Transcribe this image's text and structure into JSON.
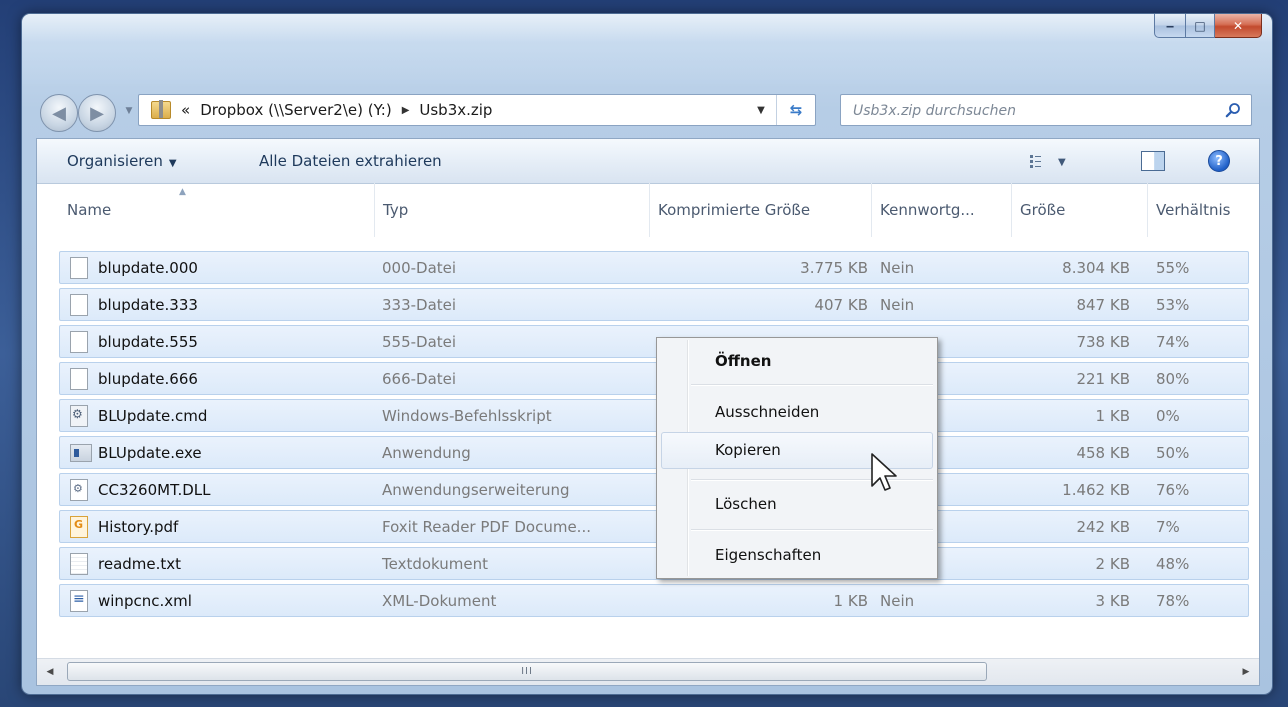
{
  "window": {
    "caption_buttons": {
      "minimize": "‒",
      "maximize": "□",
      "close": "✕"
    }
  },
  "address": {
    "chevron": "«",
    "segments": [
      "Dropbox (\\\\Server2\\e) (Y:)",
      "Usb3x.zip"
    ]
  },
  "search": {
    "placeholder": "Usb3x.zip durchsuchen"
  },
  "toolbar": {
    "organize_label": "Organisieren",
    "extract_label": "Alle Dateien extrahieren"
  },
  "columns": [
    "Name",
    "Typ",
    "Komprimierte Größe",
    "Kennwortg...",
    "Größe",
    "Verhältnis"
  ],
  "files": [
    {
      "name": "blupdate.000",
      "type": "000-Datei",
      "compressed": "3.775 KB",
      "password": "Nein",
      "size": "8.304 KB",
      "ratio": "55%",
      "icon": "blank-file-icon"
    },
    {
      "name": "blupdate.333",
      "type": "333-Datei",
      "compressed": "407 KB",
      "password": "Nein",
      "size": "847 KB",
      "ratio": "53%",
      "icon": "blank-file-icon"
    },
    {
      "name": "blupdate.555",
      "type": "555-Datei",
      "compressed": "",
      "password": "",
      "size": "738 KB",
      "ratio": "74%",
      "icon": "blank-file-icon"
    },
    {
      "name": "blupdate.666",
      "type": "666-Datei",
      "compressed": "",
      "password": "",
      "size": "221 KB",
      "ratio": "80%",
      "icon": "blank-file-icon"
    },
    {
      "name": "BLUpdate.cmd",
      "type": "Windows-Befehlsskript",
      "compressed": "",
      "password": "",
      "size": "1 KB",
      "ratio": "0%",
      "icon": "script-file-icon"
    },
    {
      "name": "BLUpdate.exe",
      "type": "Anwendung",
      "compressed": "",
      "password": "",
      "size": "458 KB",
      "ratio": "50%",
      "icon": "application-icon"
    },
    {
      "name": "CC3260MT.DLL",
      "type": "Anwendungserweiterung",
      "compressed": "",
      "password": "",
      "size": "1.462 KB",
      "ratio": "76%",
      "icon": "dll-file-icon"
    },
    {
      "name": "History.pdf",
      "type": "Foxit Reader PDF Docume...",
      "compressed": "",
      "password": "",
      "size": "242 KB",
      "ratio": "7%",
      "icon": "pdf-file-icon"
    },
    {
      "name": "readme.txt",
      "type": "Textdokument",
      "compressed": "",
      "password": "",
      "size": "2 KB",
      "ratio": "48%",
      "icon": "text-file-icon"
    },
    {
      "name": "winpcnc.xml",
      "type": "XML-Dokument",
      "compressed": "1 KB",
      "password": "Nein",
      "size": "3 KB",
      "ratio": "78%",
      "icon": "xml-file-icon"
    }
  ],
  "context_menu": {
    "items": [
      "Öffnen",
      "Ausschneiden",
      "Kopieren",
      "Löschen",
      "Eigenschaften"
    ],
    "highlighted": "Kopieren"
  },
  "scrollbar": {
    "grip": "III"
  },
  "colors": {
    "selection": "#dceafa",
    "accent": "#1e395b"
  }
}
